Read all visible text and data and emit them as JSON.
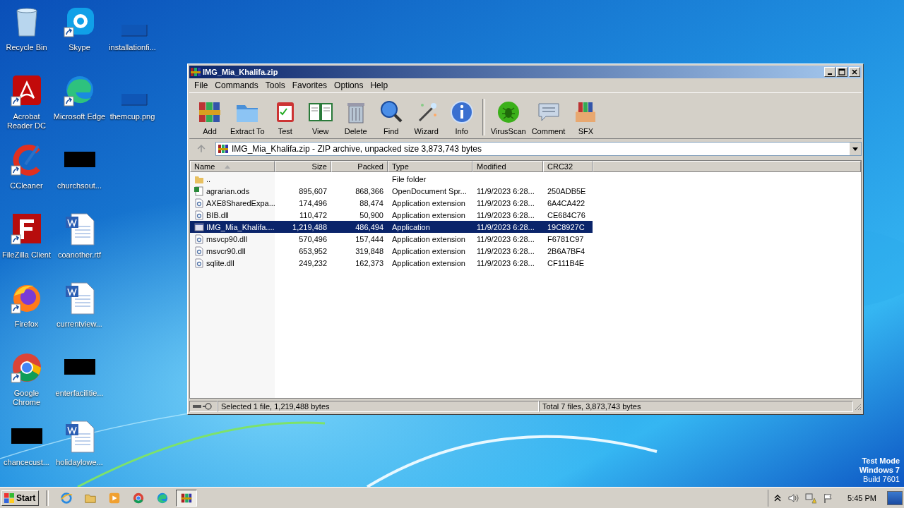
{
  "desktop_icons": [
    {
      "label": "Recycle Bin",
      "kind": "recycle",
      "shortcut": false
    },
    {
      "label": "Skype",
      "kind": "skype",
      "shortcut": true
    },
    {
      "label": "installationfi...",
      "kind": "blank",
      "shortcut": false
    },
    {
      "label": "Acrobat Reader DC",
      "kind": "acrobat",
      "shortcut": true
    },
    {
      "label": "Microsoft Edge",
      "kind": "edge",
      "shortcut": true
    },
    {
      "label": "themcup.png",
      "kind": "blank",
      "shortcut": false
    },
    {
      "label": "CCleaner",
      "kind": "ccleaner",
      "shortcut": true
    },
    {
      "label": "churchsout...",
      "kind": "black",
      "shortcut": false
    },
    {
      "label": "FileZilla Client",
      "kind": "filezilla",
      "shortcut": true
    },
    {
      "label": "coanother.rtf",
      "kind": "word",
      "shortcut": false
    },
    {
      "label": "Firefox",
      "kind": "firefox",
      "shortcut": true
    },
    {
      "label": "currentview...",
      "kind": "word",
      "shortcut": false
    },
    {
      "label": "Google Chrome",
      "kind": "chrome",
      "shortcut": true
    },
    {
      "label": "enterfacilitie...",
      "kind": "black",
      "shortcut": false
    },
    {
      "label": "chancecust...",
      "kind": "black",
      "shortcut": false
    },
    {
      "label": "holidaylowe...",
      "kind": "word",
      "shortcut": false
    }
  ],
  "window": {
    "title": "IMG_Mia_Khalifa.zip",
    "menu": [
      "File",
      "Commands",
      "Tools",
      "Favorites",
      "Options",
      "Help"
    ],
    "toolbar_groups": [
      [
        {
          "label": "Add",
          "kind": "add"
        },
        {
          "label": "Extract To",
          "kind": "extract"
        },
        {
          "label": "Test",
          "kind": "test"
        },
        {
          "label": "View",
          "kind": "view"
        },
        {
          "label": "Delete",
          "kind": "delete"
        },
        {
          "label": "Find",
          "kind": "find"
        },
        {
          "label": "Wizard",
          "kind": "wizard"
        },
        {
          "label": "Info",
          "kind": "info"
        }
      ],
      [
        {
          "label": "VirusScan",
          "kind": "virus"
        },
        {
          "label": "Comment",
          "kind": "comment"
        },
        {
          "label": "SFX",
          "kind": "sfx"
        }
      ]
    ],
    "address": "IMG_Mia_Khalifa.zip - ZIP archive, unpacked size 3,873,743 bytes",
    "columns": [
      {
        "label": "Name",
        "sorted": true
      },
      {
        "label": "Size",
        "sorted": false
      },
      {
        "label": "Packed",
        "sorted": false
      },
      {
        "label": "Type",
        "sorted": false
      },
      {
        "label": "Modified",
        "sorted": false
      },
      {
        "label": "CRC32",
        "sorted": false
      }
    ],
    "rows": [
      {
        "kind": "folder",
        "name": "..",
        "size": "",
        "packed": "",
        "type": "File folder",
        "modified": "",
        "crc": "",
        "selected": false
      },
      {
        "kind": "sheet",
        "name": "agrarian.ods",
        "size": "895,607",
        "packed": "868,366",
        "type": "OpenDocument Spr...",
        "modified": "11/9/2023 6:28...",
        "crc": "250ADB5E",
        "selected": false
      },
      {
        "kind": "dll",
        "name": "AXE8SharedExpa...",
        "size": "174,496",
        "packed": "88,474",
        "type": "Application extension",
        "modified": "11/9/2023 6:28...",
        "crc": "6A4CA422",
        "selected": false
      },
      {
        "kind": "dll",
        "name": "BIB.dll",
        "size": "110,472",
        "packed": "50,900",
        "type": "Application extension",
        "modified": "11/9/2023 6:28...",
        "crc": "CE684C76",
        "selected": false
      },
      {
        "kind": "app",
        "name": "IMG_Mia_Khalifa....",
        "size": "1,219,488",
        "packed": "486,494",
        "type": "Application",
        "modified": "11/9/2023 6:28...",
        "crc": "19C8927C",
        "selected": true
      },
      {
        "kind": "dll",
        "name": "msvcp90.dll",
        "size": "570,496",
        "packed": "157,444",
        "type": "Application extension",
        "modified": "11/9/2023 6:28...",
        "crc": "F6781C97",
        "selected": false
      },
      {
        "kind": "dll",
        "name": "msvcr90.dll",
        "size": "653,952",
        "packed": "319,848",
        "type": "Application extension",
        "modified": "11/9/2023 6:28...",
        "crc": "2B6A7BF4",
        "selected": false
      },
      {
        "kind": "dll",
        "name": "sqlite.dll",
        "size": "249,232",
        "packed": "162,373",
        "type": "Application extension",
        "modified": "11/9/2023 6:28...",
        "crc": "CF111B4E",
        "selected": false
      }
    ],
    "status_left": "Selected 1 file, 1,219,488 bytes",
    "status_right": "Total 7 files, 3,873,743 bytes"
  },
  "watermark_lines": [
    "Test Mode",
    "Windows 7",
    "Build 7601"
  ],
  "taskbar": {
    "start": "Start",
    "apps": [
      {
        "kind": "ie",
        "active": false
      },
      {
        "kind": "explorer",
        "active": false
      },
      {
        "kind": "media",
        "active": false
      },
      {
        "kind": "chrome",
        "active": false
      },
      {
        "kind": "edge",
        "active": false
      },
      {
        "kind": "winrar",
        "active": true
      }
    ],
    "time": "5:45 PM"
  }
}
